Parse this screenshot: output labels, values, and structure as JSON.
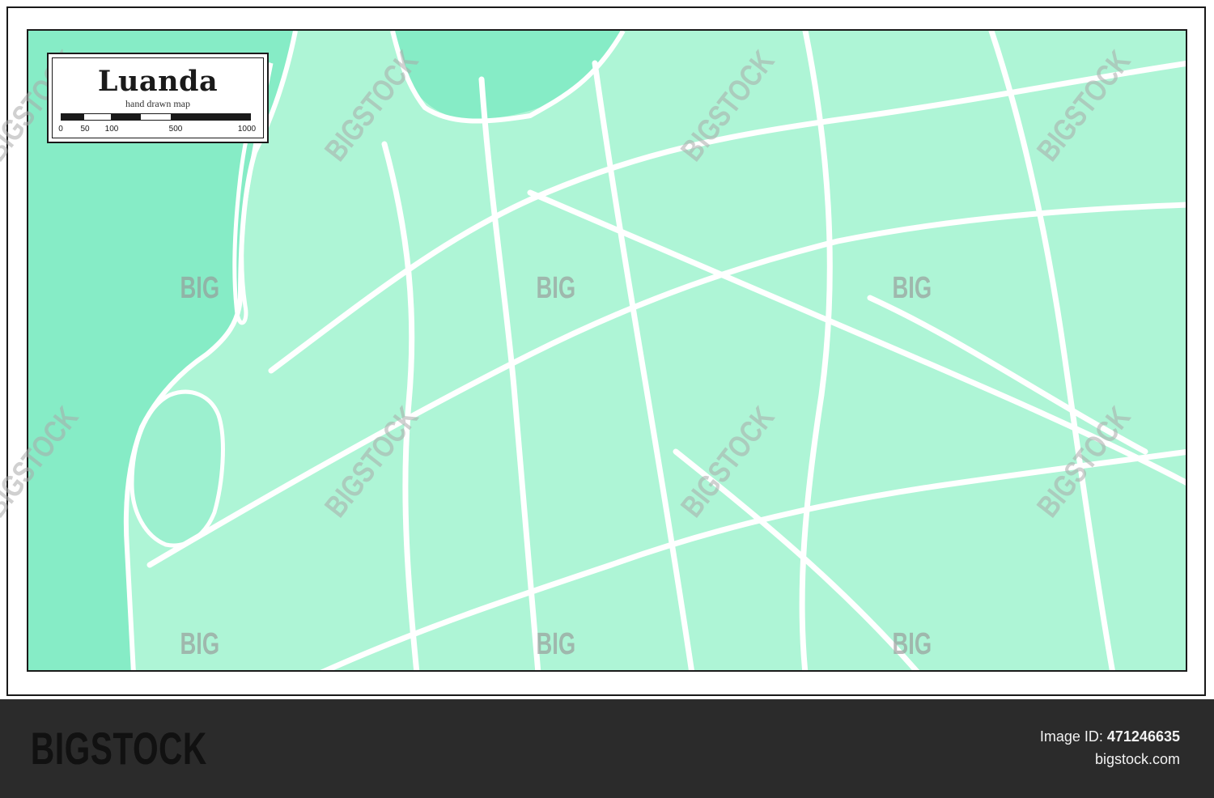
{
  "map": {
    "title": "Luanda",
    "subtitle": "hand drawn map",
    "colors": {
      "land": "#aef5d6",
      "water": "#86ecc6",
      "streets": "#ffffff",
      "border": "#1a1a1a"
    },
    "scale_labels": [
      "0",
      "50",
      "100",
      "500",
      "1000"
    ]
  },
  "watermarks": {
    "brand": "BIGSTOCK",
    "short": "BIG"
  },
  "footer": {
    "logo": "BIGSTOCK",
    "image_id_label": "Image ID:",
    "image_id": "471246635",
    "site": "bigstock.com"
  }
}
